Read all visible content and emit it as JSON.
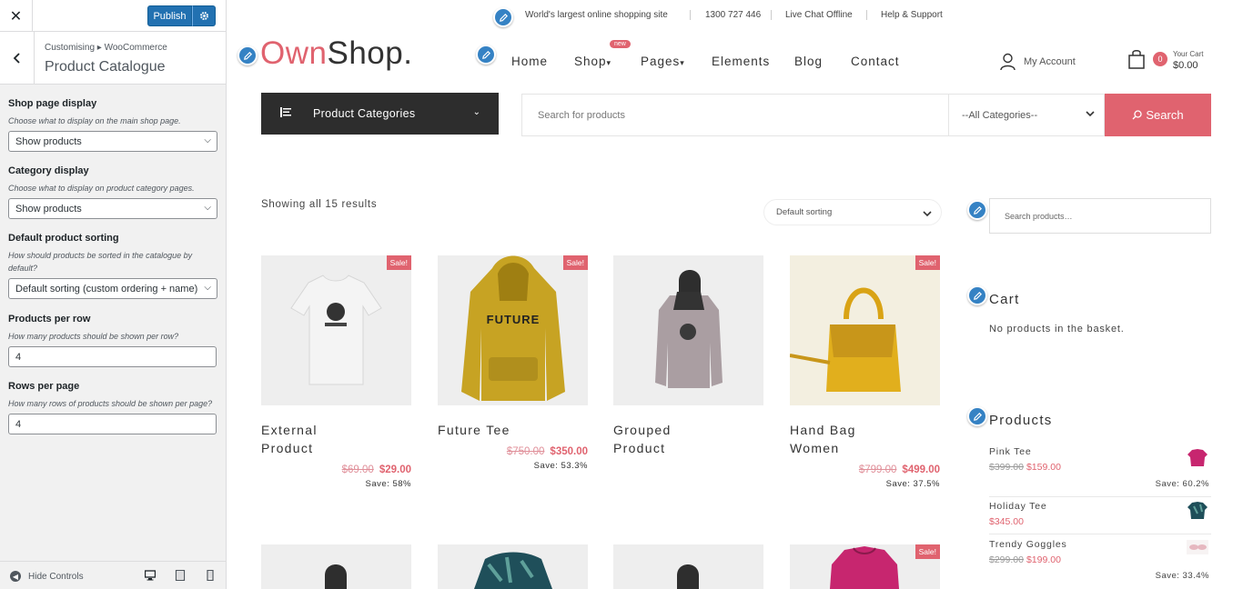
{
  "customizer": {
    "close_icon": "close-icon",
    "publish_label": "Publish",
    "breadcrumb": "Customising ▸ WooCommerce",
    "title": "Product Catalogue",
    "fields": [
      {
        "label": "Shop page display",
        "desc": "Choose what to display on the main shop page.",
        "value": "Show products"
      },
      {
        "label": "Category display",
        "desc": "Choose what to display on product category pages.",
        "value": "Show products"
      },
      {
        "label": "Default product sorting",
        "desc": "How should products be sorted in the catalogue by default?",
        "value": "Default sorting (custom ordering + name)"
      },
      {
        "label": "Products per row",
        "desc": "How many products should be shown per row?",
        "value": "4"
      },
      {
        "label": "Rows per page",
        "desc": "How many rows of products should be shown per page?",
        "value": "4"
      }
    ],
    "hide_controls": "Hide Controls"
  },
  "site": {
    "topbar": {
      "tagline": "World's largest online shopping site",
      "phone": "1300 727 446",
      "chat": "Live Chat Offline",
      "support": "Help & Support"
    },
    "logo": {
      "part1": "Own",
      "part2": "Shop."
    },
    "nav": [
      {
        "label": "Home"
      },
      {
        "label": "Shop"
      },
      {
        "label": "Pages"
      },
      {
        "label": "Elements"
      },
      {
        "label": "Blog"
      },
      {
        "label": "Contact"
      }
    ],
    "new_badge": "new",
    "account_label": "My Account",
    "cart": {
      "count": "0",
      "label": "Your Cart",
      "total": "$0.00"
    },
    "categories_label": "Product Categories",
    "search_placeholder": "Search for products",
    "search_category": "--All Categories--",
    "search_button": "Search",
    "results_text": "Showing all 15 results",
    "sorting": "Default sorting",
    "sale_label": "Sale!",
    "products": [
      {
        "name_line1": "External",
        "name_line2": "Product",
        "old_price": "$69.00",
        "price": "$29.00",
        "save": "Save: 58%",
        "sale": true
      },
      {
        "name_line1": "Future Tee",
        "name_line2": "",
        "old_price": "$750.00",
        "price": "$350.00",
        "save": "Save: 53.3%",
        "sale": true
      },
      {
        "name_line1": "Grouped",
        "name_line2": "Product",
        "old_price": "",
        "price": "",
        "save": "",
        "sale": false
      },
      {
        "name_line1": "Hand Bag",
        "name_line2": "Women",
        "old_price": "$799.00",
        "price": "$499.00",
        "save": "Save: 37.5%",
        "sale": true
      }
    ],
    "sidebar": {
      "search_placeholder": "Search products…",
      "cart_title": "Cart",
      "cart_empty": "No products in the basket.",
      "products_title": "Products",
      "items": [
        {
          "name": "Pink Tee",
          "old_price": "$399.00",
          "price": "$159.00",
          "save": "Save: 60.2%"
        },
        {
          "name": "Holiday Tee",
          "old_price": "",
          "price": "$345.00",
          "save": ""
        },
        {
          "name": "Trendy Goggles",
          "old_price": "$299.00",
          "price": "$199.00",
          "save": "Save: 33.4%"
        }
      ]
    }
  },
  "colors": {
    "accent": "#e0636f",
    "dark": "#2d2d2d",
    "wp_blue": "#2271b1"
  }
}
